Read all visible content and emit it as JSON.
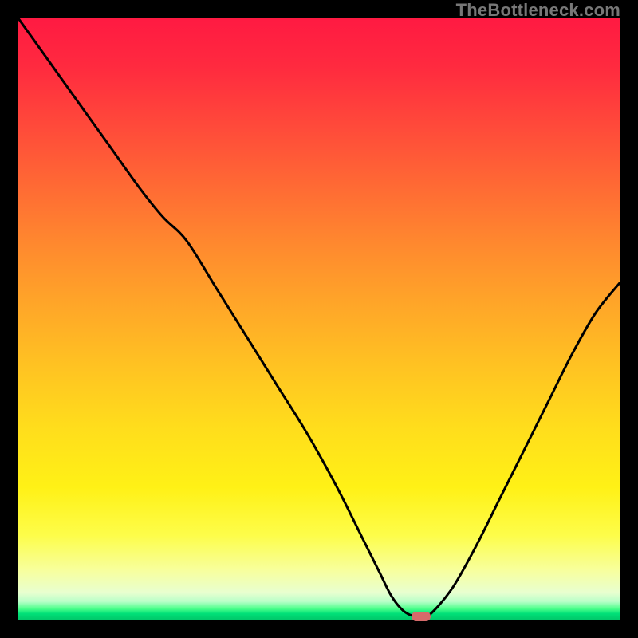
{
  "watermark": "TheBottleneck.com",
  "colors": {
    "curve": "#000000",
    "marker": "#d66a6a"
  },
  "chart_data": {
    "type": "line",
    "title": "",
    "xlabel": "",
    "ylabel": "",
    "xlim": [
      0,
      100
    ],
    "ylim": [
      0,
      100
    ],
    "grid": false,
    "legend": false,
    "series": [
      {
        "name": "bottleneck-curve",
        "x": [
          0,
          5,
          10,
          15,
          20,
          24,
          28,
          33,
          38,
          43,
          48,
          53,
          57,
          60,
          62,
          64,
          66,
          68,
          72,
          76,
          80,
          84,
          88,
          92,
          96,
          100
        ],
        "y": [
          100,
          93,
          86,
          79,
          72,
          67,
          63,
          55,
          47,
          39,
          31,
          22,
          14,
          8,
          4,
          1.5,
          0.5,
          0.5,
          5,
          12,
          20,
          28,
          36,
          44,
          51,
          56
        ]
      }
    ],
    "marker": {
      "x": 67,
      "y": 0.5
    },
    "background_gradient": "red-yellow-green vertical"
  }
}
